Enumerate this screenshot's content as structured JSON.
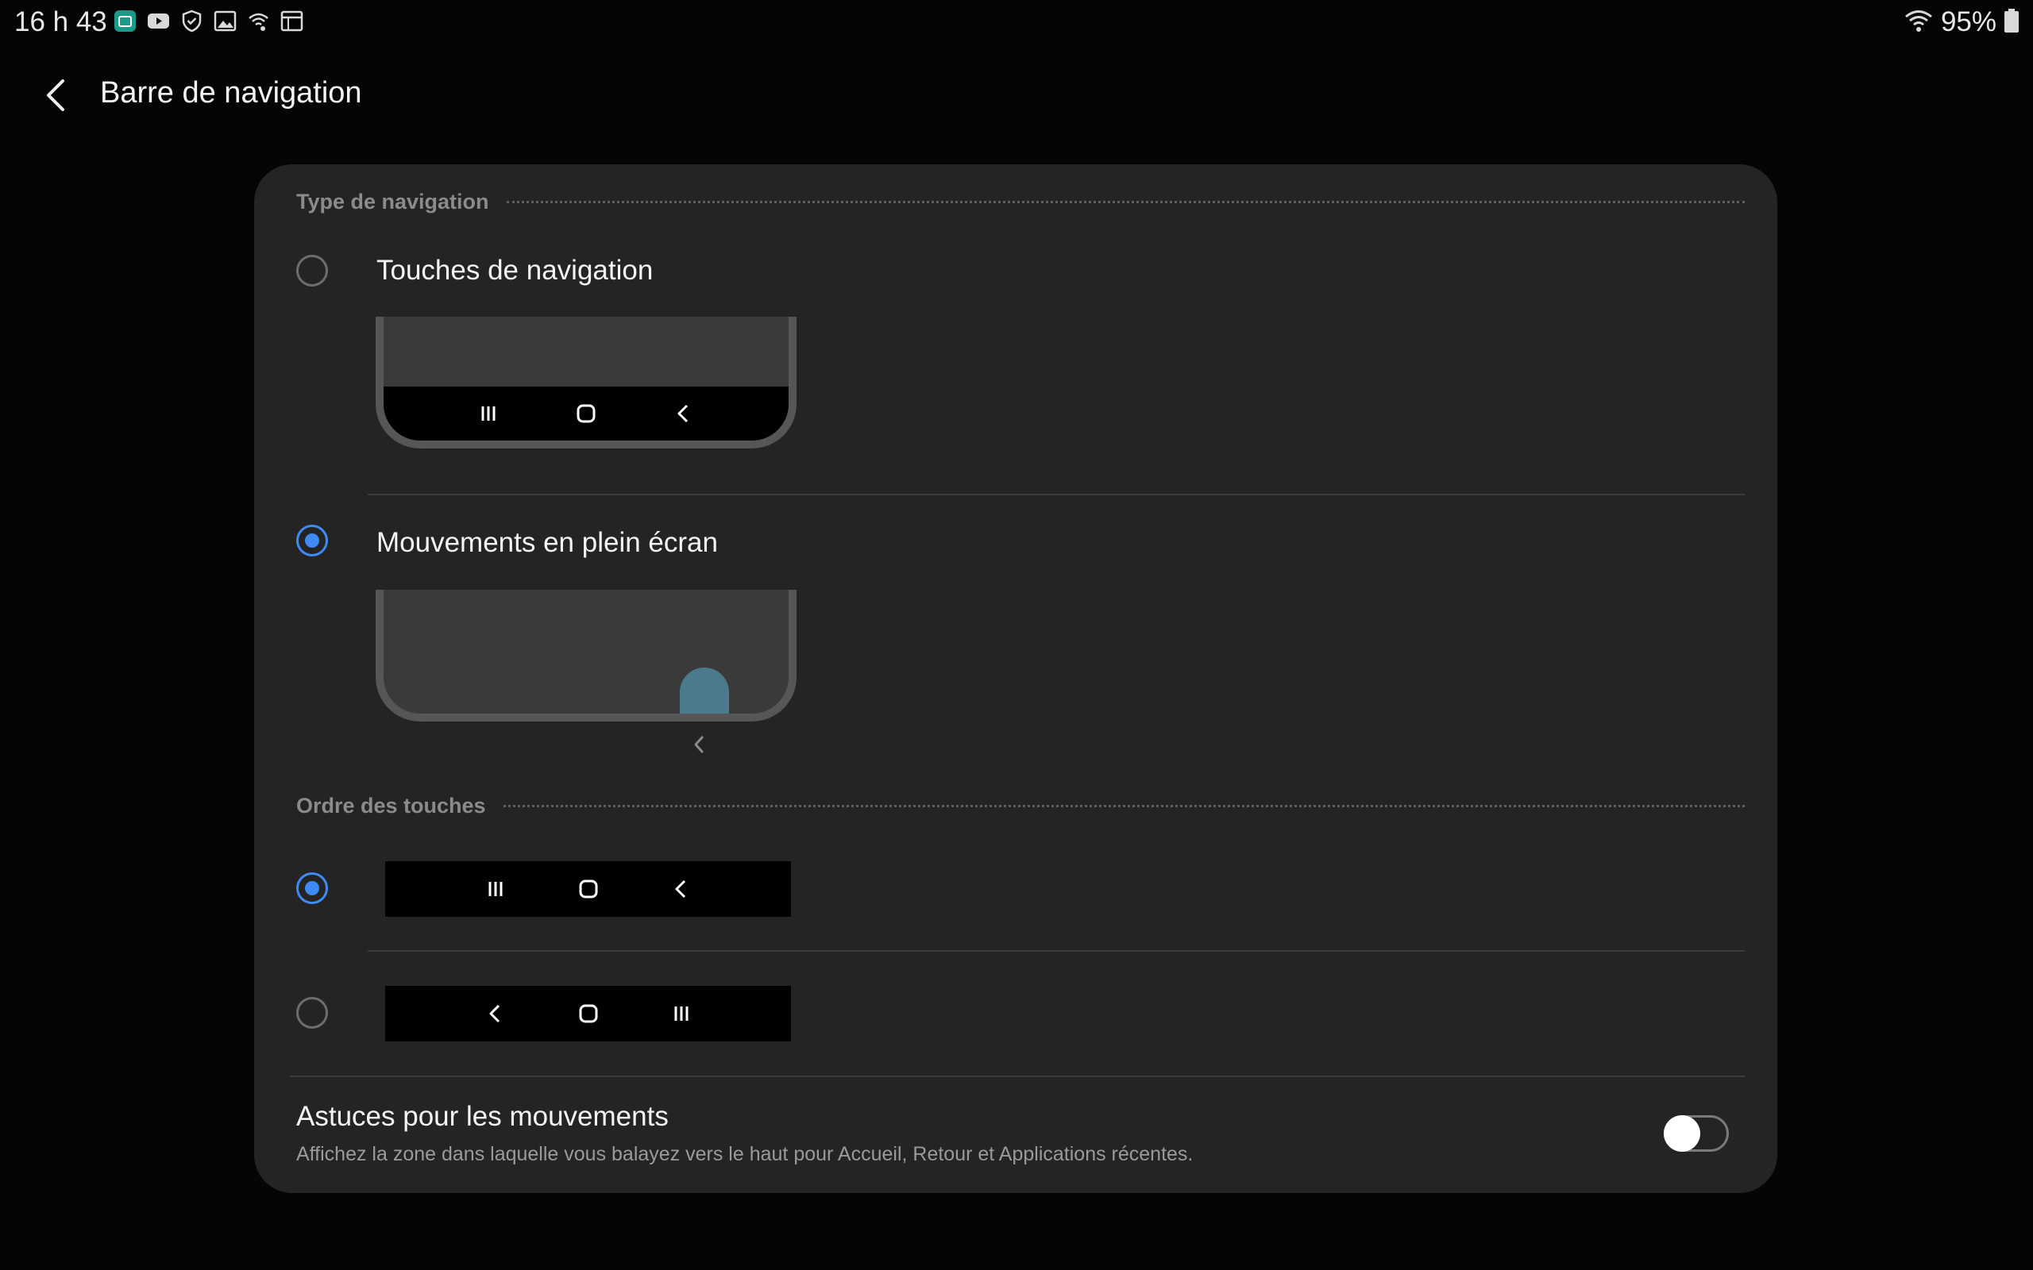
{
  "status_bar": {
    "time": "16 h 43",
    "battery_percent": "95%",
    "left_icons": [
      "calendar-icon",
      "youtube-icon",
      "shield-icon",
      "gallery-icon",
      "wifi-calling-icon",
      "news-icon"
    ],
    "right_icons": [
      "wifi-icon",
      "battery-icon"
    ]
  },
  "header": {
    "title": "Barre de navigation",
    "back_icon": "back-arrow-icon"
  },
  "navigation_type": {
    "section_label": "Type de navigation",
    "options": [
      {
        "label": "Touches de navigation",
        "selected": false
      },
      {
        "label": "Mouvements en plein écran",
        "selected": true
      }
    ]
  },
  "button_order": {
    "section_label": "Ordre des touches",
    "options": [
      {
        "order": [
          "recents-icon",
          "home-icon",
          "back-icon"
        ],
        "selected": true
      },
      {
        "order": [
          "back-icon",
          "home-icon",
          "recents-icon"
        ],
        "selected": false
      }
    ]
  },
  "gesture_hints": {
    "title": "Astuces pour les mouvements",
    "description": "Affichez la zone dans laquelle vous balayez vers le haut pour Accueil, Retour et Applications récentes.",
    "enabled": false
  },
  "colors": {
    "accent": "#3f8bf5",
    "card_bg": "#242424",
    "page_bg": "#050505",
    "gesture_pill": "#4c7a8d"
  }
}
